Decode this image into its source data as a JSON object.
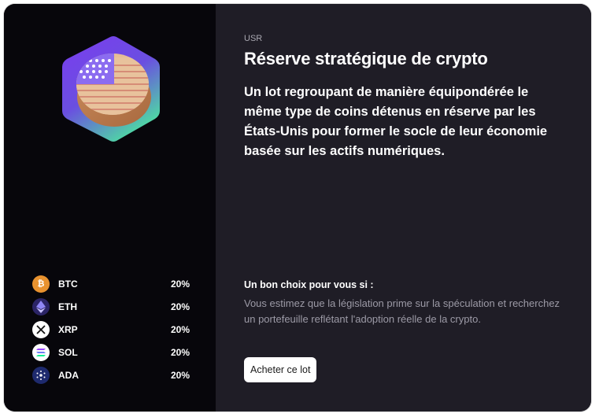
{
  "basket": {
    "ticker": "USR",
    "title": "Réserve stratégique de crypto",
    "description": "Un lot regroupant de manière équipondérée le même type de coins détenus en réserve par les États-Unis pour former le socle de leur économie basée sur les actifs numériques."
  },
  "coins": [
    {
      "symbol": "BTC",
      "percent": "20%",
      "icon": "bitcoin-icon",
      "color": "#e8922f"
    },
    {
      "symbol": "ETH",
      "percent": "20%",
      "icon": "ethereum-icon",
      "color": "#4a3a8c"
    },
    {
      "symbol": "XRP",
      "percent": "20%",
      "icon": "xrp-icon",
      "color": "#ffffff"
    },
    {
      "symbol": "SOL",
      "percent": "20%",
      "icon": "solana-icon",
      "color": "#ffffff"
    },
    {
      "symbol": "ADA",
      "percent": "20%",
      "icon": "cardano-icon",
      "color": "#1e2a6e"
    }
  ],
  "good_choice": {
    "title": "Un bon choix pour vous si :",
    "text": "Vous estimez que la législation prime sur la spéculation et recherchez un portefeuille reflétant l'adoption réelle de la crypto."
  },
  "actions": {
    "buy_label": "Acheter ce lot"
  },
  "colors": {
    "left_panel": "#07060b",
    "right_panel": "#1f1d26",
    "hex_gradient_top": "#7b3cf0",
    "hex_gradient_bottom": "#4fd6a5"
  }
}
